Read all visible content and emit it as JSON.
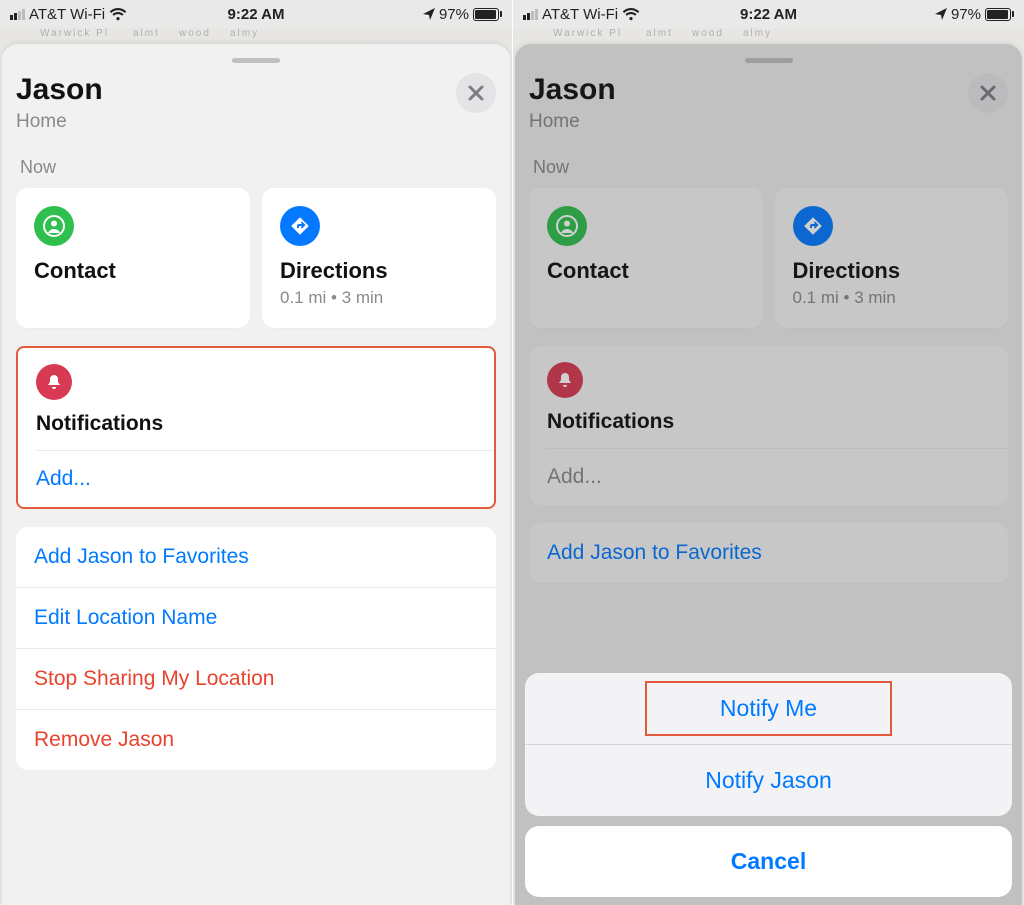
{
  "status": {
    "carrier": "AT&T Wi-Fi",
    "time": "9:22 AM",
    "battery": "97%"
  },
  "map": {
    "street_peek": "Warwick Pl"
  },
  "person": {
    "name": "Jason",
    "location_label": "Home",
    "timestamp": "Now"
  },
  "cards": {
    "contact": {
      "title": "Contact"
    },
    "directions": {
      "title": "Directions",
      "subtitle": "0.1 mi • 3 min"
    }
  },
  "notifications": {
    "title": "Notifications",
    "add_label": "Add..."
  },
  "actions": {
    "favorites": "Add Jason to Favorites",
    "edit_name": "Edit Location Name",
    "stop_sharing": "Stop Sharing My Location",
    "remove": "Remove Jason"
  },
  "sheet": {
    "notify_me": "Notify Me",
    "notify_other": "Notify Jason",
    "cancel": "Cancel"
  }
}
